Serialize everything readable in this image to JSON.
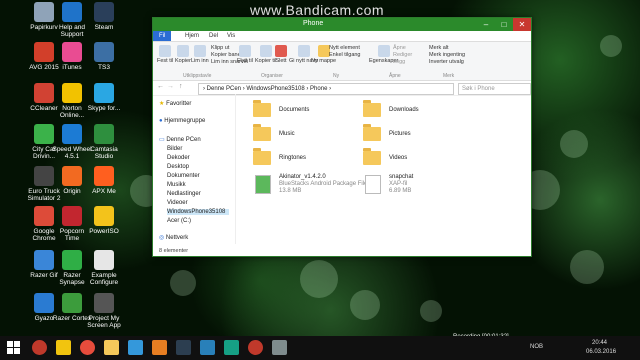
{
  "watermark": "www.Bandicam.com",
  "desktop_icons": [
    {
      "label": "Papirkurv",
      "color": "#8fa3b8"
    },
    {
      "label": "Help and Support",
      "color": "#1f73c9"
    },
    {
      "label": "Steam",
      "color": "#2a3f5a"
    },
    {
      "label": "AVG 2015",
      "color": "#d23f2a"
    },
    {
      "label": "iTunes",
      "color": "#e94c92"
    },
    {
      "label": "TS3",
      "color": "#3c6fa4"
    },
    {
      "label": "CCleaner",
      "color": "#d14233"
    },
    {
      "label": "Norton Online...",
      "color": "#f2c200"
    },
    {
      "label": "Skype for...",
      "color": "#2aa7e3"
    },
    {
      "label": "City Car Drivin...",
      "color": "#3bb24a"
    },
    {
      "label": "Speed Wheel 4.5.1",
      "color": "#1c7bd4"
    },
    {
      "label": "Camtasia Studio",
      "color": "#2e8f3e"
    },
    {
      "label": "Euro Truck Simulator 2",
      "color": "#444444"
    },
    {
      "label": "Origin",
      "color": "#f26a21"
    },
    {
      "label": "APX Me",
      "color": "#ff5f1f"
    },
    {
      "label": "Google Chrome",
      "color": "#dd4b39"
    },
    {
      "label": "Popcorn Time",
      "color": "#c2262f"
    },
    {
      "label": "PowerISO",
      "color": "#f3c31b"
    },
    {
      "label": "Razer Gif",
      "color": "#3a86d8"
    },
    {
      "label": "Razer Synapse",
      "color": "#2fae46"
    },
    {
      "label": "Example Configure",
      "color": "#e6e6e6"
    },
    {
      "label": "Gyazo",
      "color": "#2a7bd2"
    },
    {
      "label": "Razer Cortex",
      "color": "#3c9c3c"
    },
    {
      "label": "Project My Screen App",
      "color": "#555555"
    }
  ],
  "window": {
    "title": "Phone",
    "tabs": [
      "Fil",
      "Hjem",
      "Del",
      "Vis"
    ],
    "ribbon": {
      "clipboard": [
        "Fest til",
        "Kopier",
        "Lim inn",
        "Klipp ut",
        "Kopier bane",
        "Lim inn snarvei"
      ],
      "organize": [
        "Flytt til",
        "Kopier til",
        "Slett",
        "Gi nytt navn"
      ],
      "new": [
        "Ny mappe",
        "Nytt element",
        "Enkel tilgang"
      ],
      "open": [
        "Egenskaper",
        "Åpne",
        "Rediger",
        "Logg"
      ],
      "select": [
        "Merk alt",
        "Merk ingenting",
        "Inverter utvalg"
      ],
      "group_labels": [
        "Utklippstavle",
        "Organiser",
        "Ny",
        "Åpne",
        "Merk"
      ]
    },
    "address_path": "›  Denne PCen  ›  WindowsPhone35108  ›  Phone  ›",
    "search_placeholder": "Søk i Phone",
    "nav": [
      "Favoritter",
      "Hjemmegruppe",
      "Denne PCen",
      "Bilder",
      "Dekoder",
      "Desktop",
      "Dokumenter",
      "Musikk",
      "Nedlastinger",
      "Videoer",
      "WindowsPhone35108",
      "Acer (C:)",
      "Nettverk"
    ],
    "items": [
      {
        "name": "Documents",
        "type": "folder"
      },
      {
        "name": "Downloads",
        "type": "folder"
      },
      {
        "name": "Music",
        "type": "folder"
      },
      {
        "name": "Pictures",
        "type": "folder"
      },
      {
        "name": "Ringtones",
        "type": "folder"
      },
      {
        "name": "Videos",
        "type": "folder"
      },
      {
        "name": "Akinator_v1.4.2.0",
        "desc": "BlueStacks Android Package File",
        "size": "13.8 MB",
        "type": "file"
      },
      {
        "name": "snapchat",
        "desc": "XAP-fil",
        "size": "6.89 MB",
        "type": "file"
      }
    ],
    "status": "8 elementer"
  },
  "taskbar": {
    "recording": "Recording [00:01:32]",
    "lang": "NOB",
    "time": "20:44",
    "date": "06.03.2016"
  }
}
